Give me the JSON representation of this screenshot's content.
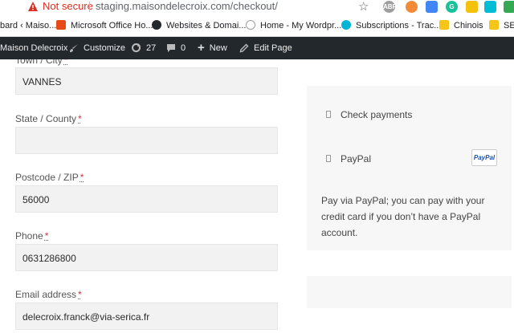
{
  "browser": {
    "security_label": "Not secure",
    "url": "staging.maisondelecroix.com/checkout/",
    "extensions": [
      {
        "icon": "adblock-icon",
        "text": "ABP",
        "color": "#9e9e9e"
      },
      {
        "icon": "extension-orange-icon",
        "text": "",
        "color": "#f28b38"
      },
      {
        "icon": "translate-icon",
        "text": "",
        "color": "#4285f4"
      },
      {
        "icon": "grammarly-icon",
        "text": "G",
        "color": "#15c39a"
      },
      {
        "icon": "extension-yellow-icon",
        "text": "",
        "color": "#f4c20d"
      },
      {
        "icon": "extension-cyan-icon",
        "text": "",
        "color": "#00bcd4"
      },
      {
        "icon": "extension-green-icon",
        "text": "",
        "color": "#34a853"
      }
    ]
  },
  "bookmarks": [
    {
      "label": "bard ‹ Maiso...",
      "icon": "wordpress-icon",
      "color": "#ffffff"
    },
    {
      "label": "Microsoft Office Ho...",
      "icon": "office-icon",
      "color": "#e64a19"
    },
    {
      "label": "Websites & Domai...",
      "icon": "p-icon",
      "color": "#23282d"
    },
    {
      "label": "Home - My Wordpr...",
      "icon": "wordpress-home-icon",
      "color": "#9e9e9e"
    },
    {
      "label": "Subscriptions - Trac...",
      "icon": "splash-icon",
      "color": "#00b4d8"
    },
    {
      "label": "Chinois",
      "icon": "folder-icon",
      "color": "#f5c518"
    },
    {
      "label": "SEO",
      "icon": "folder-icon",
      "color": "#f5c518"
    }
  ],
  "adminbar": {
    "site_name": "Maison Delecroix",
    "customize": "Customize",
    "updates_count": "27",
    "comments_count": "0",
    "new": "New",
    "edit_page": "Edit Page"
  },
  "form": {
    "town_label": "Town / City",
    "town_value": "VANNES",
    "state_label": "State / County",
    "state_value": "",
    "postcode_label": "Postcode / ZIP",
    "postcode_value": "56000",
    "phone_label": "Phone",
    "phone_value": "0631286800",
    "email_label": "Email address",
    "email_value": "delecroix.franck@via-serica.fr",
    "required_marker": "*"
  },
  "payment": {
    "check_label": "Check payments",
    "paypal_label": "PayPal",
    "paypal_badge": "PayPal",
    "paypal_description": "Pay via PayPal; you can pay with your credit card if you don’t have a PayPal account."
  }
}
